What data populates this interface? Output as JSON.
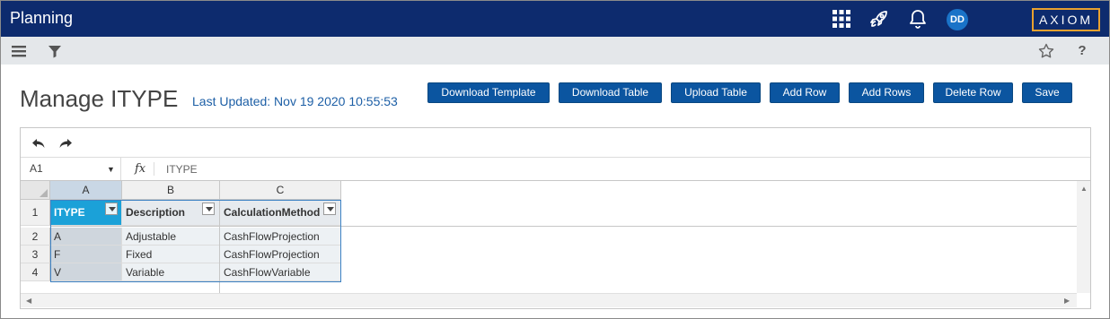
{
  "header": {
    "app_title": "Planning",
    "avatar_initials": "DD",
    "logo_text": "AXIOM",
    "icons": [
      "apps-grid-icon",
      "rocket-icon",
      "bell-icon"
    ]
  },
  "subnav": {
    "icons": [
      "menu-icon",
      "filter-icon",
      "star-icon",
      "help-icon"
    ],
    "help_glyph": "?"
  },
  "page": {
    "title": "Manage ITYPE",
    "last_updated": "Last Updated: Nov 19 2020 10:55:53"
  },
  "toolbar": {
    "buttons": [
      "Download Template",
      "Download Table",
      "Upload Table",
      "Add Row",
      "Add Rows",
      "Delete Row",
      "Save"
    ]
  },
  "spreadsheet": {
    "name_box": "A1",
    "formula_value": "ITYPE",
    "fx_label": "fx",
    "columns": [
      "A",
      "B",
      "C"
    ],
    "row_numbers": [
      "1",
      "2",
      "3",
      "4"
    ],
    "headers": [
      "ITYPE",
      "Description",
      "CalculationMethod"
    ],
    "rows": [
      [
        "A",
        "Adjustable",
        "CashFlowProjection"
      ],
      [
        "F",
        "Fixed",
        "CashFlowProjection"
      ],
      [
        "V",
        "Variable",
        "CashFlowVariable"
      ]
    ]
  },
  "colors": {
    "topbar": "#0d2b6e",
    "button": "#0b55a0",
    "accent": "#1ba1d8",
    "logo_border": "#e8a12f",
    "link_text": "#1d5fa6"
  }
}
